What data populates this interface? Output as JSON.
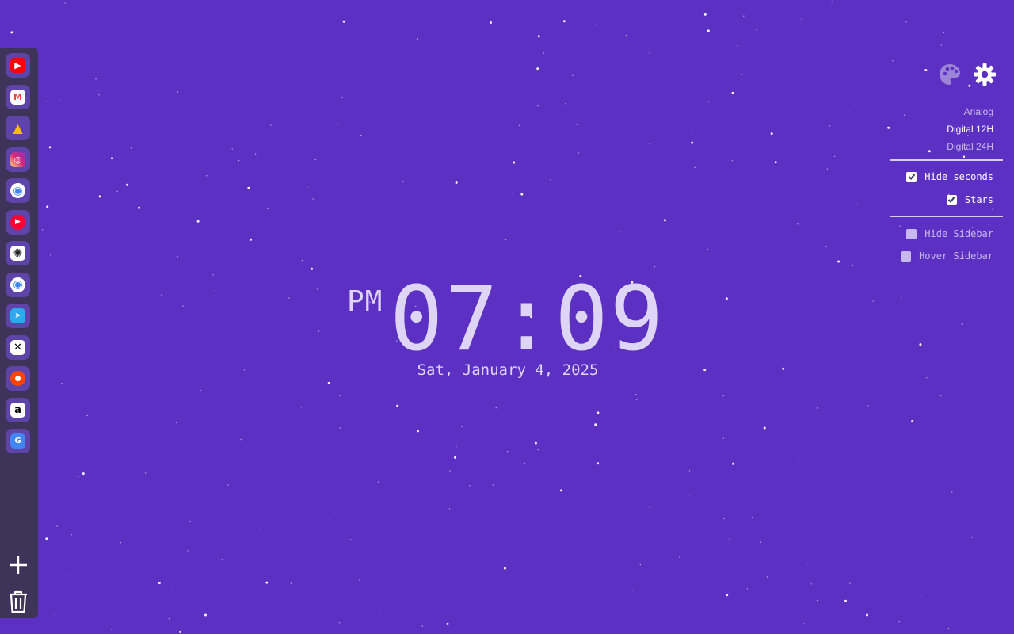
{
  "clock": {
    "ampm": "PM",
    "time": "07:09",
    "date": "Sat, January 4, 2025"
  },
  "sidebar": {
    "items": [
      {
        "name": "youtube",
        "icon": "youtube-icon",
        "glyph": "▶",
        "color": "#ff0000"
      },
      {
        "name": "gmail",
        "icon": "gmail-icon",
        "glyph": "M",
        "color": "#ea4335"
      },
      {
        "name": "google-drive",
        "icon": "google-drive-icon",
        "glyph": "▲",
        "color": "#0f9d58"
      },
      {
        "name": "instagram",
        "icon": "instagram-icon",
        "glyph": "◎",
        "color": "#e1306c"
      },
      {
        "name": "chrome-1",
        "icon": "chrome-icon",
        "glyph": "◉",
        "color": "#fbbc05"
      },
      {
        "name": "youtube-music",
        "icon": "youtube-music-icon",
        "glyph": "▶",
        "color": "#ff0033"
      },
      {
        "name": "chatgpt",
        "icon": "chatgpt-icon",
        "glyph": "✺",
        "color": "#ffffff"
      },
      {
        "name": "chrome-2",
        "icon": "chrome-icon",
        "glyph": "◉",
        "color": "#fbbc05"
      },
      {
        "name": "telegram",
        "icon": "telegram-icon",
        "glyph": "➤",
        "color": "#2aabee"
      },
      {
        "name": "x",
        "icon": "x-icon",
        "glyph": "𝕏",
        "color": "#000000"
      },
      {
        "name": "reddit",
        "icon": "reddit-icon",
        "glyph": "●",
        "color": "#ff4500"
      },
      {
        "name": "amazon",
        "icon": "amazon-icon",
        "glyph": "a",
        "color": "#ffffff"
      },
      {
        "name": "google-translate",
        "icon": "google-translate-icon",
        "glyph": "G",
        "color": "#4285f4"
      }
    ],
    "add_icon": "plus-icon",
    "delete_icon": "trash-icon"
  },
  "settings": {
    "icons": [
      "palette-icon",
      "gear-icon"
    ],
    "modes": [
      {
        "label": "Analog",
        "active": false
      },
      {
        "label": "Digital 12H",
        "active": true
      },
      {
        "label": "Digital 24H",
        "active": false
      }
    ],
    "options": [
      {
        "label": "Hide seconds",
        "checked": true
      },
      {
        "label": "Stars",
        "checked": true
      },
      {
        "label": "Hide Sidebar",
        "checked": false
      },
      {
        "label": "Hover Sidebar",
        "checked": false
      }
    ]
  },
  "colors": {
    "background": "#5b30c2",
    "sidebar": "#3e3358",
    "text": "#ded4f6"
  }
}
